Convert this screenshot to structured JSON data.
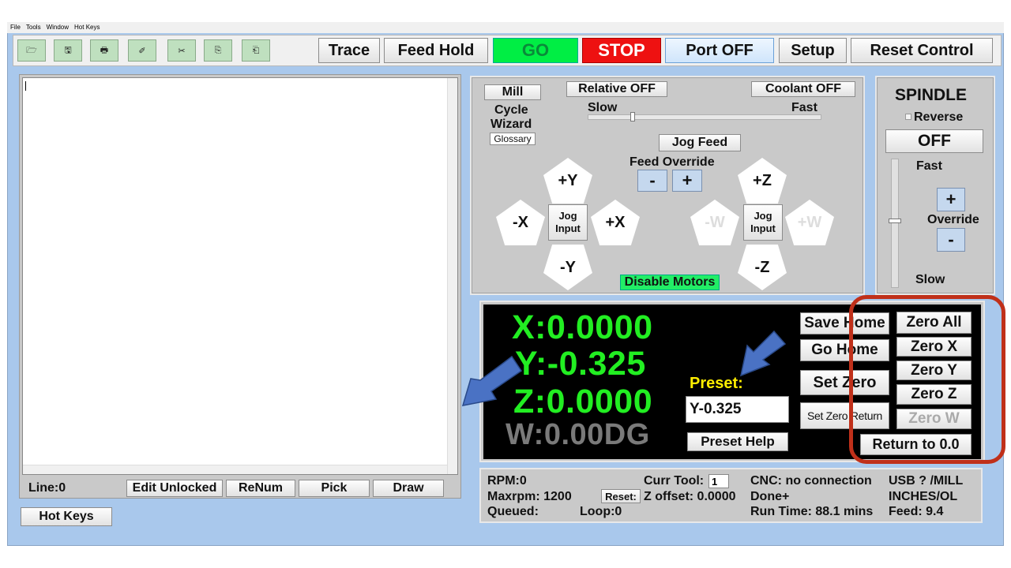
{
  "menu": [
    "File",
    "Tools",
    "Window",
    "Hot Keys"
  ],
  "toolbar": {
    "icons": [
      "folder-open-icon",
      "save-disk-icon",
      "print-icon",
      "eraser-icon",
      "scissors-icon",
      "copy-icon",
      "paste-icon"
    ],
    "icon_glyphs": [
      "🗁",
      "🖫",
      "🖶",
      "✐",
      "✂",
      "⎘",
      "⎗"
    ],
    "trace": "Trace",
    "feed_hold": "Feed Hold",
    "go": "GO",
    "stop": "STOP",
    "port": "Port OFF",
    "setup": "Setup",
    "reset_control": "Reset Control"
  },
  "editor": {
    "line": "Line:0",
    "edit": "Edit Unlocked",
    "renum": "ReNum",
    "pick": "Pick",
    "draw": "Draw",
    "hot_keys": "Hot Keys"
  },
  "jog": {
    "mill": "Mill",
    "cycle": "Cycle",
    "wizard": "Wizard",
    "glossary": "Glossary",
    "relative": "Relative OFF",
    "coolant": "Coolant OFF",
    "slow": "Slow",
    "fast": "Fast",
    "jog_feed": "Jog Feed",
    "feed_override": "Feed Override",
    "minus": "-",
    "plus": "+",
    "py": "+Y",
    "my": "-Y",
    "mx": "-X",
    "px": "+X",
    "pz": "+Z",
    "mz": "-Z",
    "mw": "-W",
    "pw": "+W",
    "jog_input": "Jog Input",
    "disable_motors": "Disable Motors"
  },
  "spindle": {
    "title": "SPINDLE",
    "reverse": "Reverse",
    "state": "OFF",
    "fast": "Fast",
    "plus": "+",
    "override": "Override",
    "minus": "-",
    "slow": "Slow"
  },
  "dro": {
    "x": "X:0.0000",
    "y": "Y:-0.325",
    "z": "Z:0.0000",
    "w": "W:0.00DG",
    "preset_label": "Preset:",
    "preset_value": "Y-0.325",
    "preset_help": "Preset Help",
    "save_home": "Save Home",
    "go_home": "Go Home",
    "set_zero": "Set Zero",
    "set_zero_return": "Set Zero Return",
    "zero_all": "Zero All",
    "zero_x": "Zero X",
    "zero_y": "Zero Y",
    "zero_z": "Zero Z",
    "zero_w": "Zero W",
    "return": "Return to 0.0"
  },
  "status": {
    "rpm": "RPM:0",
    "maxrpm": "Maxrpm: 1200",
    "queued": "Queued:",
    "loop": "Loop:0",
    "reset": "Reset:",
    "curr_tool": "Curr Tool:",
    "tool_value": "1",
    "z_offset": "Z offset: 0.0000",
    "cnc": "CNC: no connection",
    "done": "Done+",
    "run_time": "Run Time: 88.1 mins",
    "usb": "USB ? /MILL",
    "units": "INCHES/OL",
    "feed": "Feed: 9.4"
  },
  "colors": {
    "go_bg": "#00ee44",
    "stop_bg": "#ee1111",
    "dro_text": "#22ee22",
    "highlight": "#c0301a",
    "arrow": "#4a72c4"
  }
}
